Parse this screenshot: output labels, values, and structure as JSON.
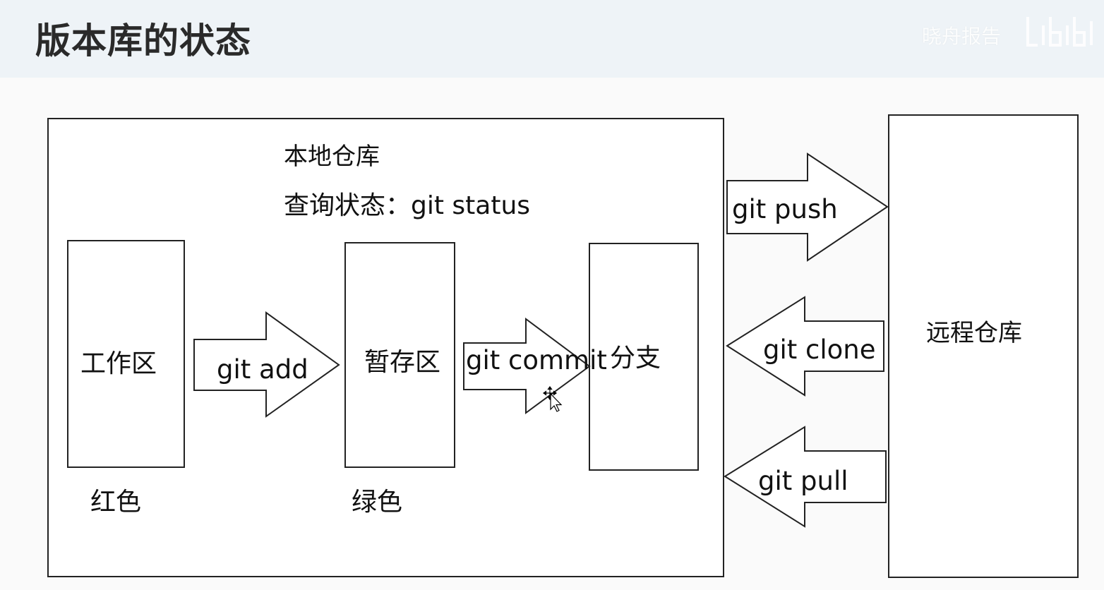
{
  "slide": {
    "title": "版本库的状态",
    "watermark": "晓舟报告"
  },
  "diagram": {
    "local_repo": {
      "label": "本地仓库",
      "status_cmd": "查询状态：git status"
    },
    "remote_repo": {
      "label": "远程仓库"
    },
    "areas": {
      "working": {
        "label": "工作区",
        "color_note": "红色"
      },
      "staging": {
        "label": "暂存区",
        "color_note": "绿色"
      },
      "branch": {
        "label": "分支"
      }
    },
    "commands": {
      "add": "git add",
      "commit": "git commit",
      "push": "git push",
      "clone": "git clone",
      "pull": "git pull"
    }
  },
  "icons": {
    "cursor": "move-cursor-icon",
    "logo": "bilibili-logo-icon"
  },
  "colors": {
    "header_bg": "#eef3f7",
    "stroke": "#222222"
  }
}
